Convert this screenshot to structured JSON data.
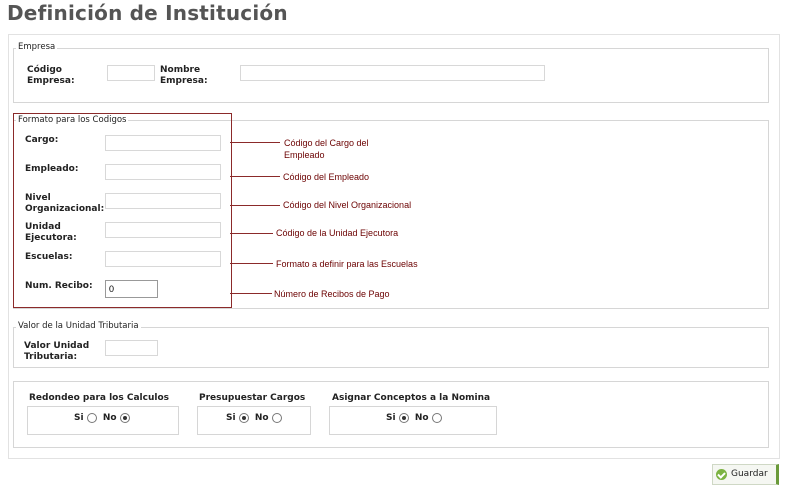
{
  "page": {
    "title": "Definición de Institución"
  },
  "empresa": {
    "legend": "Empresa",
    "codigo_label": "Código Empresa:",
    "nombre_label": "Nombre Empresa:",
    "codigo_value": "",
    "nombre_value": ""
  },
  "formato": {
    "legend": "Formato para los Codigos",
    "fields": [
      {
        "label": "Cargo:",
        "value": "",
        "note": "Código del Cargo del Empleado"
      },
      {
        "label": "Empleado:",
        "value": "",
        "note": "Código del Empleado"
      },
      {
        "label": "Nivel Organizacional:",
        "value": "",
        "note": "Código del Nivel Organizacional"
      },
      {
        "label": "Unidad Ejecutora:",
        "value": "",
        "note": "Código de la Unidad Ejecutora"
      },
      {
        "label": "Escuelas:",
        "value": "",
        "note": "Formato a definir para las Escuelas"
      },
      {
        "label": "Num. Recibo:",
        "value": "0",
        "note": "Número de Recibos de Pago"
      }
    ]
  },
  "tributaria": {
    "legend": "Valor de la Unidad Tributaria",
    "label": "Valor Unidad Tributaria:",
    "value": ""
  },
  "options": [
    {
      "title": "Redondeo para los Calculos",
      "si": "Si",
      "no": "No",
      "selected": "No"
    },
    {
      "title": "Presupuestar Cargos",
      "si": "Si",
      "no": "No",
      "selected": "Si"
    },
    {
      "title": "Asignar Conceptos a la Nomina",
      "si": "Si",
      "no": "No",
      "selected": "Si"
    }
  ],
  "save_button": {
    "label": "Guardar",
    "icon": "check-circle-icon"
  },
  "colors": {
    "annotation": "#8b2a2a",
    "button_accent": "#6a9a3a"
  }
}
